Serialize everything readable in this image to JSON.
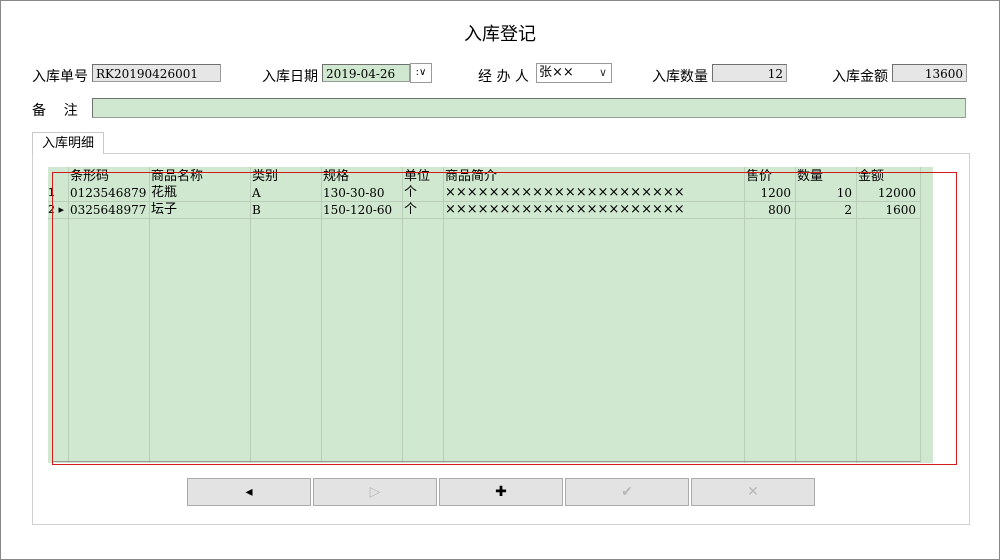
{
  "window": {
    "title": "入库登记"
  },
  "form": {
    "order_no_label": "入库单号",
    "order_no_value": "RK20190426001",
    "date_label": "入库日期",
    "date_value": "2019-04-26",
    "handler_label": "经 办 人",
    "handler_value": "张××",
    "qty_label": "入库数量",
    "qty_value": "12",
    "amount_label": "入库金额",
    "amount_value": "13600",
    "note_label": "备    注",
    "note_value": ""
  },
  "tab": {
    "label": "入库明细"
  },
  "grid": {
    "columns": [
      "条形码",
      "商品名称",
      "类别",
      "规格",
      "单位",
      "商品简介",
      "售价",
      "数量",
      "金额"
    ],
    "rows": [
      {
        "row_header": "1",
        "barcode": "0123546879",
        "name": "花瓶",
        "category": "A",
        "spec": "130-30-80",
        "unit": "个",
        "desc": "××××××××××××××××××××××",
        "price": "1200",
        "qty": "10",
        "amount": "12000"
      },
      {
        "row_header": "2 ▸",
        "barcode": "0325648977",
        "name": "坛子",
        "category": "B",
        "spec": "150-120-60",
        "unit": "个",
        "desc": "××××××××××××××××××××××",
        "price": "800",
        "qty": "2",
        "amount": "1600"
      }
    ]
  },
  "buttons": {
    "prev": "◂",
    "next": "▷",
    "add": "✚",
    "confirm": "✔",
    "delete": "✕"
  },
  "icons": {
    "dropdown": "chevron-down-icon"
  }
}
